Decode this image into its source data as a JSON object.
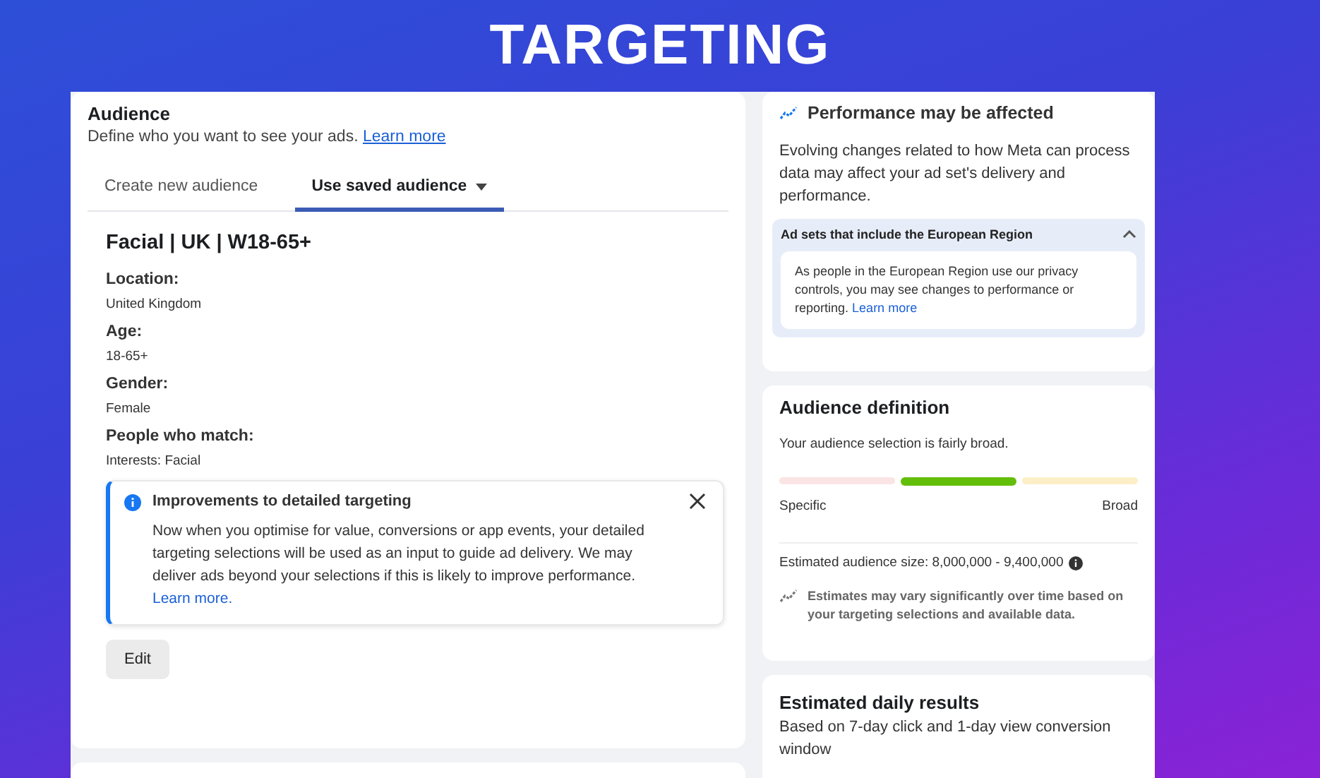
{
  "banner": {
    "title": "TARGETING"
  },
  "audience": {
    "title": "Audience",
    "description": "Define who you want to see your ads.",
    "link": "Learn more",
    "tabs": [
      {
        "label": "Create new audience",
        "selected": false,
        "dropdown": false
      },
      {
        "label": "Use saved audience",
        "selected": true,
        "dropdown": true
      }
    ],
    "saved_name": "Facial | UK | W18-65+",
    "fields": [
      {
        "label": "Location:",
        "value": "United Kingdom"
      },
      {
        "label": "Age:",
        "value": "18-65+"
      },
      {
        "label": "Gender:",
        "value": "Female"
      },
      {
        "label": "People who match:",
        "value": "Interests: Facial"
      }
    ],
    "notice": {
      "title": "Improvements to detailed targeting",
      "body": "Now when you optimise for value, conversions or app events, your detailed targeting selections will be used as an input to guide ad delivery. We may deliver ads beyond your selections if this is likely to improve performance.",
      "link": "Learn more."
    },
    "edit_button": "Edit"
  },
  "performance": {
    "title": "Performance may be affected",
    "body": "Evolving changes related to how Meta can process data may affect your ad set's delivery and performance.",
    "section": {
      "title": "Ad sets that include the European Region",
      "expanded": true,
      "body": "As people in the European Region use our privacy controls, you may see changes to performance or reporting.",
      "link": "Learn more"
    }
  },
  "audience_definition": {
    "title": "Audience definition",
    "summary": "Your audience selection is fairly broad.",
    "segments": [
      {
        "selected": false,
        "color": "#fbe4e4"
      },
      {
        "selected": true,
        "color": "#63be09"
      },
      {
        "selected": false,
        "color": "#fcefc7"
      }
    ],
    "min_label": "Specific",
    "max_label": "Broad",
    "size": "Estimated audience size: 8,000,000 - 9,400,000",
    "note": "Estimates may vary significantly over time based on your targeting selections and available data."
  },
  "daily_results": {
    "title": "Estimated daily results",
    "body": "Based on 7-day click and 1-day view conversion window"
  }
}
